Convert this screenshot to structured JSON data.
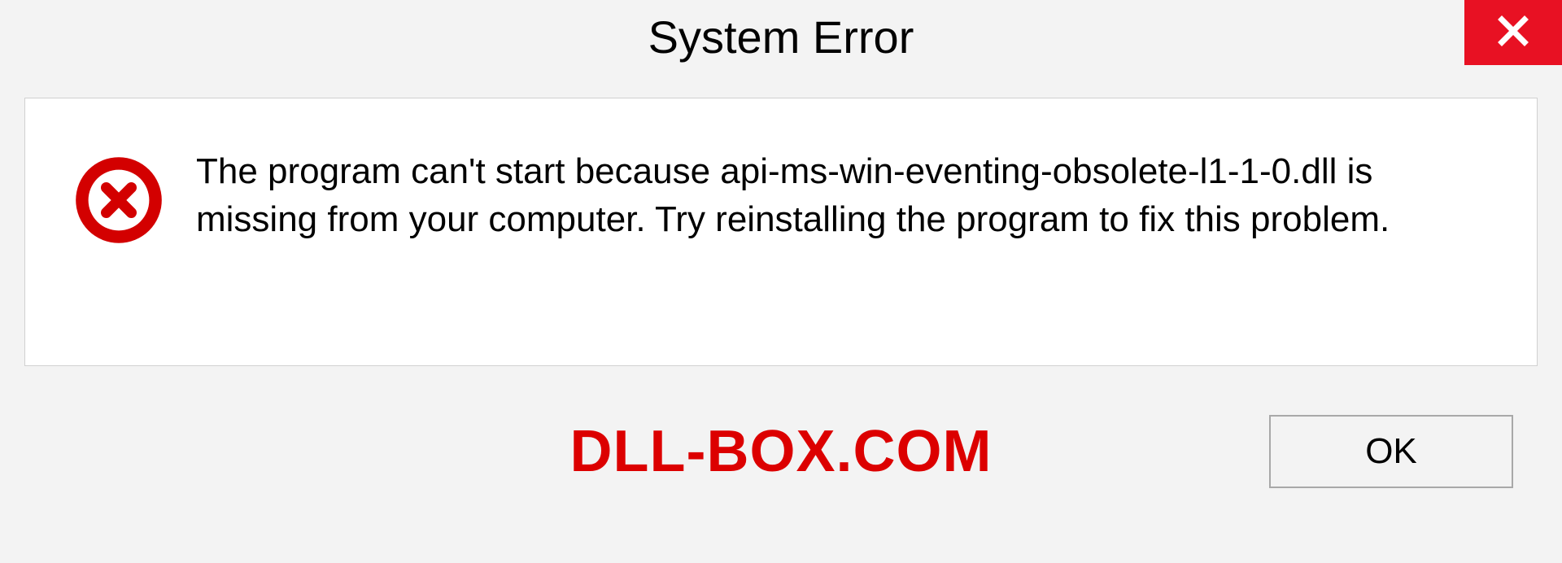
{
  "titlebar": {
    "title": "System Error"
  },
  "dialog": {
    "message": "The program can't start because api-ms-win-eventing-obsolete-l1-1-0.dll is missing from your computer. Try reinstalling the program to fix this problem."
  },
  "footer": {
    "watermark": "DLL-BOX.COM",
    "ok_label": "OK"
  },
  "colors": {
    "close_bg": "#e81123",
    "error_icon": "#d30000",
    "watermark": "#dc0000"
  }
}
